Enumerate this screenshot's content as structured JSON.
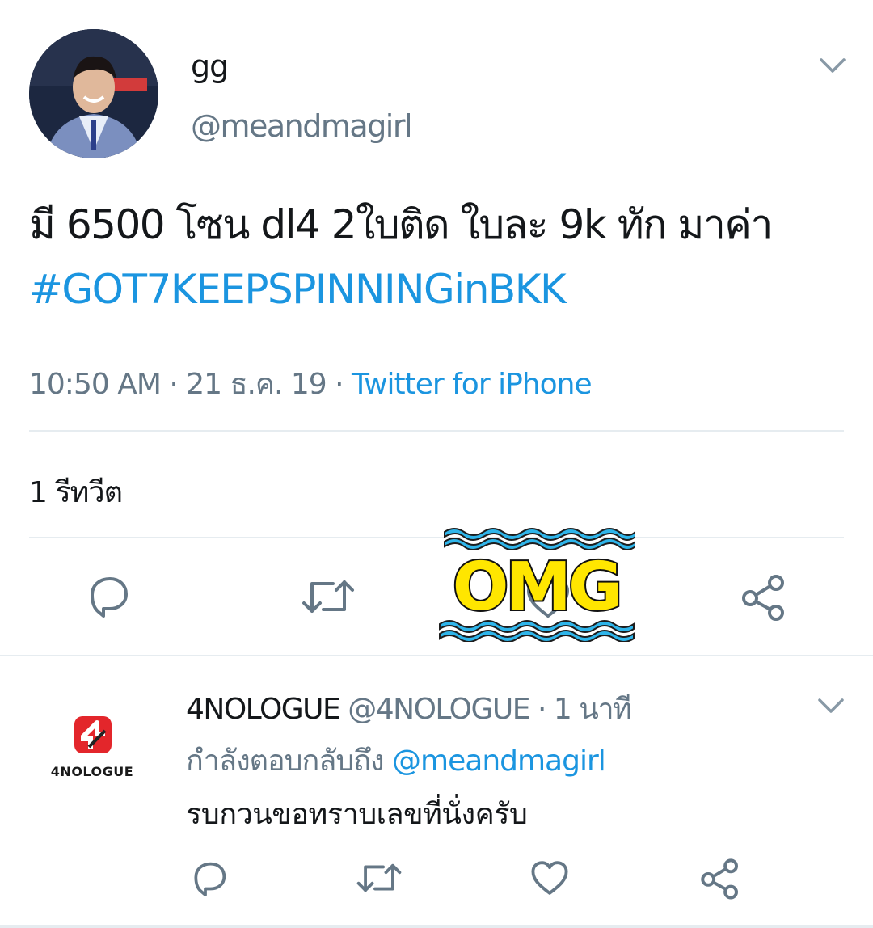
{
  "tweet": {
    "display_name": "gg",
    "handle": "@meandmagirl",
    "text": "มี 6500 โซน dl4 2ใบติด ใบละ 9k ทัก มาค่า",
    "hashtag": "#GOT7KEEPSPINNINGinBKK",
    "time": "10:50 AM",
    "date": "21 ธ.ค. 19",
    "separator": " · ",
    "source": "Twitter for iPhone",
    "retweets_label": "1 รีทวีต",
    "avatar_icon": "profile-photo",
    "menu_icon": "chevron-down-icon"
  },
  "actions": [
    "reply-icon",
    "retweet-icon",
    "like-icon",
    "share-icon"
  ],
  "sticker": {
    "text": "OMG",
    "fill_color": "#ffe600",
    "wave_color": "#2fb5ea"
  },
  "reply": {
    "display_name": "4NOLOGUE",
    "handle": "@4NOLOGUE",
    "time": "1 นาที",
    "replying_prefix": "กำลังตอบกลับถึง",
    "replying_to": "@meandmagirl",
    "text": "รบกวนขอทราบเลขที่นั่งครับ",
    "avatar_logo_text": "4NOLOGUE",
    "brand_color": "#e3262b"
  },
  "colors": {
    "text": "#14171a",
    "secondary": "#657786",
    "link": "#1b95e0",
    "divider": "#e6ecf0"
  }
}
